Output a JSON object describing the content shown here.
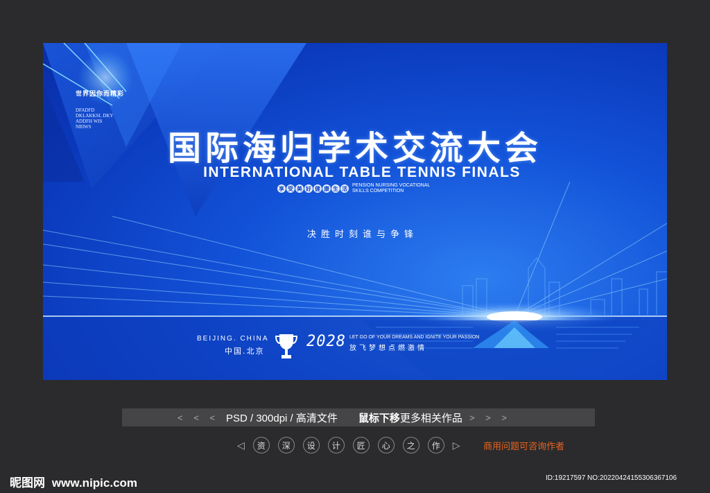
{
  "poster": {
    "small_title": "世界因你而精彩",
    "small_lines": [
      "DFADFD",
      "DKLAKKSL DKY",
      "ADDFH WIS",
      "NRIWS"
    ],
    "title_cn": "国际海归学术交流大会",
    "title_en": "INTERNATIONAL TABLE TENNIS FINALS",
    "badges": [
      "享",
      "受",
      "美",
      "好",
      "健",
      "康",
      "生",
      "活"
    ],
    "badge_en_1": "PENSION NURSING VOCATIONAL",
    "badge_en_2": "SKILLS COMPETITION",
    "slogan": "决胜时刻谁与争锋",
    "city_en": "BEIJING. CHINA",
    "city_cn": "中国.北京",
    "year": "2028",
    "tag_en": "LET GO OF YOUR DREAMS AND IGNITE YOUR PASSION",
    "tag_cn": "放飞梦想点燃激情"
  },
  "infobar": {
    "left_arrows": "< < <",
    "format": "PSD /  300dpi /  高清文件",
    "hint_bold": "鼠标下移",
    "hint_rest": "更多相关作品",
    "right_arrows": "> > >"
  },
  "nav": {
    "prev": "◁",
    "chars": [
      "资",
      "深",
      "设",
      "计",
      "匠",
      "心",
      "之",
      "作"
    ],
    "next": "▷",
    "contact": "商用问题可咨询作者"
  },
  "footer": {
    "logo_cn": "昵图网",
    "site": "www.nipic.com",
    "id_text": "ID:19217597 NO:20220424155306367106"
  }
}
